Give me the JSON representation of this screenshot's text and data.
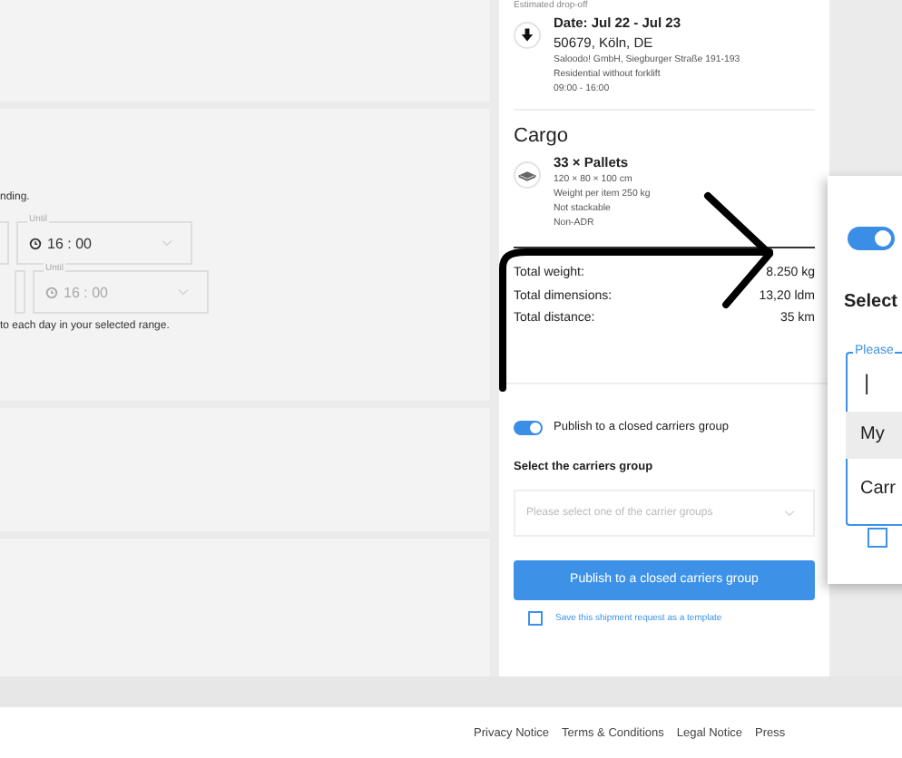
{
  "form": {
    "hint": "nding.",
    "time_rows": [
      {
        "label": "Until",
        "value": "16 : 00",
        "disabled": false
      },
      {
        "label": "Until",
        "value": "16 : 00",
        "disabled": true
      }
    ],
    "note": "to each day in your selected range."
  },
  "summary": {
    "dropoff": {
      "heading": "Estimated drop-off",
      "date": "Date: Jul 22 - Jul 23",
      "city": "50679, Köln, DE",
      "lines": [
        "Saloodo! GmbH, Siegburger Straße 191-193",
        "Residential without forklift",
        "09:00 - 16:00"
      ]
    },
    "cargo": {
      "title": "Cargo",
      "item": "33 × Pallets",
      "details": [
        "120 × 80 × 100 cm",
        "Weight per item 250 kg",
        "Not stackable",
        "Non-ADR"
      ]
    },
    "totals": [
      {
        "label": "Total weight:",
        "value": "8.250 kg"
      },
      {
        "label": "Total dimensions:",
        "value": "13,20 ldm"
      },
      {
        "label": "Total distance:",
        "value": "35 km"
      }
    ],
    "publish_toggle": {
      "label": "Publish to a closed carriers group",
      "on": true
    },
    "group_label": "Select the carriers group",
    "group_select": {
      "placeholder": "Please select one of the carrier groups"
    },
    "submit": "Publish to a closed carriers group",
    "template_checkbox": {
      "label": "Save this shipment request as a template",
      "checked": false
    }
  },
  "zoom_popup": {
    "toggle": {
      "on": true
    },
    "label": "Select",
    "field_label": "Please",
    "cursor": "|",
    "options": [
      {
        "label": "My",
        "selected": true
      },
      {
        "label": "Carr",
        "selected": false
      }
    ],
    "checkbox": {
      "checked": false
    }
  },
  "footer_links": [
    "Privacy Notice",
    "Terms & Conditions",
    "Legal Notice",
    "Press"
  ]
}
